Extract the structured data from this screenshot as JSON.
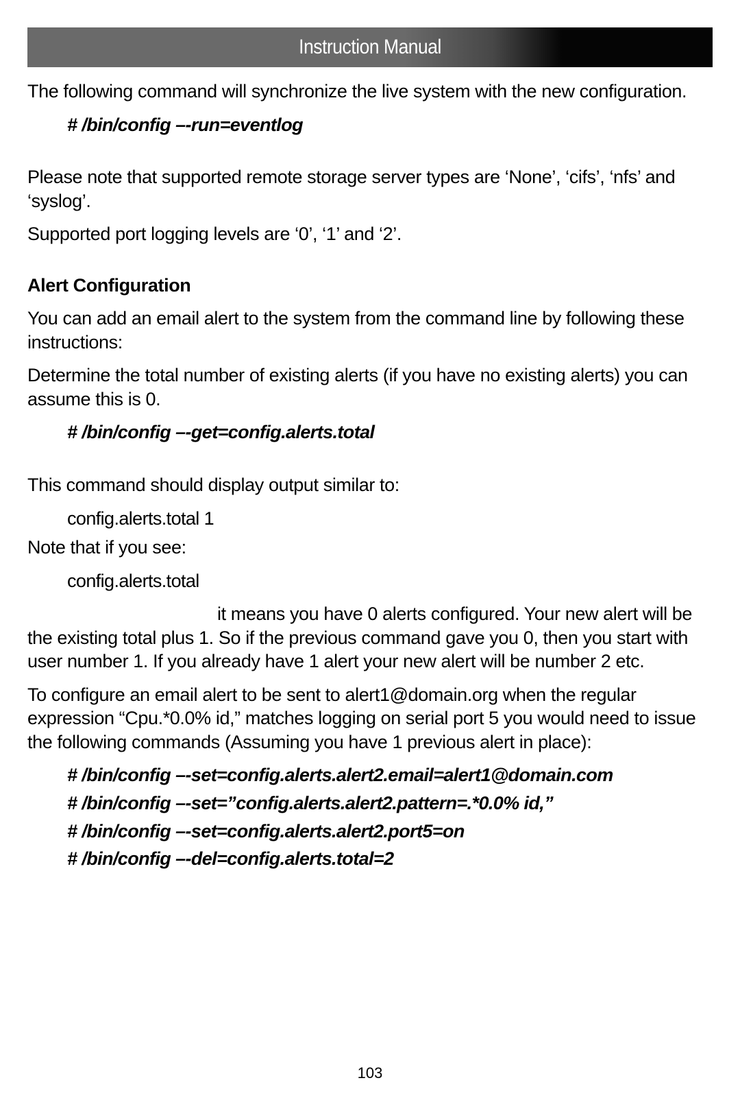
{
  "header": {
    "title": "Instruction Manual"
  },
  "content": {
    "p1": "The following command will synchronize the live system with the new configuration.",
    "cmd1": "# /bin/config –-run=eventlog",
    "p2": "Please note that supported remote storage server types are ‘None’, ‘cifs’, ‘nfs’ and ‘syslog’.",
    "p3": "Supported port logging levels are ‘0’, ‘1’ and ‘2’.",
    "h1": "Alert Configuration",
    "p4": "You can add an email alert to the system from the command line by following these instructions:",
    "p5": "Determine the total number of existing alerts (if you have no existing alerts) you can assume this is 0.",
    "cmd2": "# /bin/config –-get=config.alerts.total",
    "p6": "This command should display output similar to:",
    "out1": "config.alerts.total 1",
    "p7": "Note that if you see:",
    "out2": "config.alerts.total",
    "p8": "it means you have 0 alerts configured. Your new alert will be the existing total plus 1. So if the previous command gave you 0, then you start with user number 1. If you already have 1 alert your new alert will be number 2 etc.",
    "p9": "To configure an email alert to be sent to alert1@domain.org when the regular expression “Cpu.*0.0% id,” matches logging on serial port 5 you would need to issue the following commands (Assuming you have 1 previous alert in place):",
    "cmd3": "# /bin/config –-set=config.alerts.alert2.email=alert1@domain.com",
    "cmd4": "# /bin/config –-set=”config.alerts.alert2.pattern=.*0.0% id,”",
    "cmd5": "# /bin/config –-set=config.alerts.alert2.port5=on",
    "cmd6": "# /bin/config –-del=config.alerts.total=2"
  },
  "pageNumber": "103"
}
